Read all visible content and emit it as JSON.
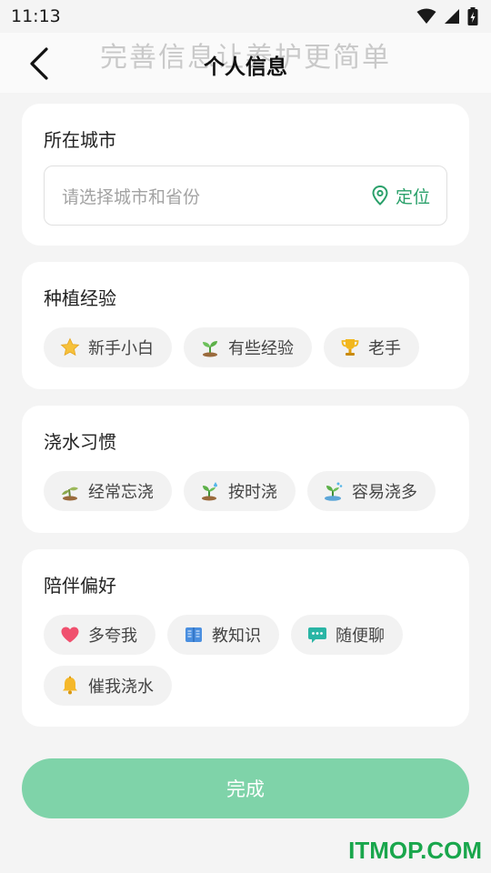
{
  "status": {
    "time": "11:13"
  },
  "header": {
    "ghost_title": "完善信息让养护更简单",
    "title": "个人信息"
  },
  "city": {
    "title": "所在城市",
    "placeholder": "请选择城市和省份",
    "locate_label": "定位"
  },
  "experience": {
    "title": "种植经验",
    "options": [
      {
        "label": "新手小白",
        "icon": "star-icon"
      },
      {
        "label": "有些经验",
        "icon": "sprout-icon"
      },
      {
        "label": "老手",
        "icon": "trophy-icon"
      }
    ]
  },
  "watering": {
    "title": "浇水习惯",
    "options": [
      {
        "label": "经常忘浇",
        "icon": "dry-plant-icon"
      },
      {
        "label": "按时浇",
        "icon": "watered-plant-icon"
      },
      {
        "label": "容易浇多",
        "icon": "overwatered-plant-icon"
      }
    ]
  },
  "companion": {
    "title": "陪伴偏好",
    "options": [
      {
        "label": "多夸我",
        "icon": "heart-icon"
      },
      {
        "label": "教知识",
        "icon": "book-icon"
      },
      {
        "label": "随便聊",
        "icon": "chat-bubble-icon"
      },
      {
        "label": "催我浇水",
        "icon": "bell-icon"
      }
    ]
  },
  "done_label": "完成",
  "watermark": "ITMOP.COM",
  "colors": {
    "accent": "#2aa06a",
    "button": "#7fd3a9",
    "watermark": "#19a64c"
  }
}
